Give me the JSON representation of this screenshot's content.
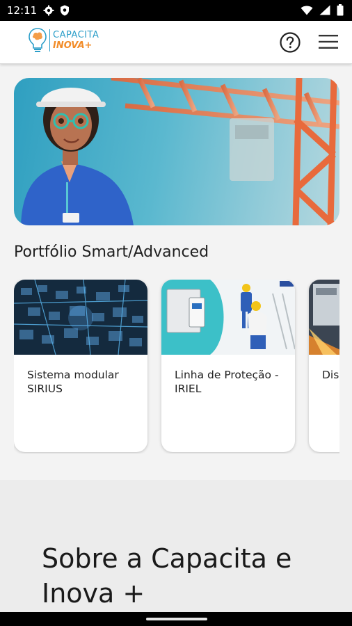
{
  "status_bar": {
    "time": "12:11",
    "left_icons": [
      "gear-icon",
      "shield-icon"
    ],
    "right_icons": [
      "wifi-icon",
      "signal-icon",
      "battery-icon"
    ]
  },
  "app_bar": {
    "logo_line1": "CAPACITA",
    "logo_line2": "INOVA+",
    "help_icon": "help-circle-icon",
    "menu_icon": "hamburger-menu-icon"
  },
  "hero": {
    "image": "hero-banner-avatar-crane"
  },
  "portfolio": {
    "title": "Portfólio Smart/Advanced",
    "cards": [
      {
        "title": "Sistema modular SIRIUS",
        "image": "sirius-modules-image"
      },
      {
        "title": "Linha de Proteção - IRIEL",
        "image": "iriel-protection-image"
      },
      {
        "title": "Dis Cai",
        "image": "panel-image"
      }
    ]
  },
  "about": {
    "title": "Sobre a Capacita e Inova +"
  },
  "colors": {
    "brand_blue": "#2b9ec9",
    "brand_orange": "#f28c28",
    "background": "#f3f3f3"
  }
}
